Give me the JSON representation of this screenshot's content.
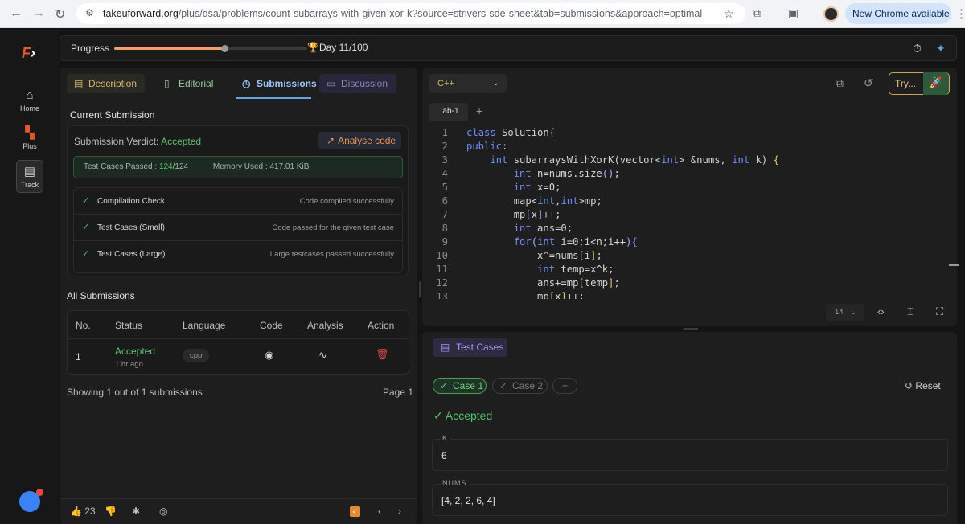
{
  "browser": {
    "url_host": "takeuforward.org",
    "url_path": "/plus/dsa/problems/count-subarrays-with-given-xor-k?source=strivers-sde-sheet&tab=submissions&approach=optimal",
    "new_chrome": "New Chrome available"
  },
  "rail": {
    "logo_letter": "F",
    "items": [
      {
        "label": "Home",
        "icon": "home-icon"
      },
      {
        "label": "Plus",
        "icon": "grid-icon"
      },
      {
        "label": "Track",
        "icon": "document-icon"
      }
    ]
  },
  "progress": {
    "label": "Progress",
    "fraction": 0.11,
    "trophy": "🏆",
    "day_text": "Day 11/100"
  },
  "tabs": {
    "description": "Description",
    "editorial": "Editorial",
    "submissions": "Submissions",
    "discussion": "Discussion",
    "active": "submissions"
  },
  "current": {
    "heading": "Current Submission",
    "verdict_label": "Submission Verdict:",
    "verdict": "Accepted",
    "analyse_button": "Analyse code",
    "tests_passed_label": "Test Cases Passed :",
    "tests_passed": "124",
    "tests_total": "/124",
    "memory_used": "Memory Used : 417.01 KiB",
    "checks": [
      {
        "name": "Compilation Check",
        "detail": "Code compiled successfully"
      },
      {
        "name": "Test Cases (Small)",
        "detail": "Code passed for the given test case"
      },
      {
        "name": "Test Cases (Large)",
        "detail": "Large testcases passed successfully"
      }
    ]
  },
  "all": {
    "heading": "All Submissions",
    "columns": [
      "No.",
      "Status",
      "Language",
      "Code",
      "Analysis",
      "Action"
    ],
    "rows": [
      {
        "no": "1",
        "status": "Accepted",
        "time": "1 hr ago",
        "language": "cpp"
      }
    ],
    "showing": "Showing 1 out of 1 submissions",
    "page": "Page 1"
  },
  "footer": {
    "likes": "23"
  },
  "editor": {
    "language": "C++",
    "try_label": "Try...",
    "tab": "Tab-1",
    "font_size": "14",
    "lines": [
      "1",
      "2",
      "3",
      "4",
      "5",
      "6",
      "7",
      "8",
      "9",
      "10",
      "11",
      "12",
      "13"
    ]
  },
  "tests": {
    "title": "Test Cases",
    "case1": "Case 1",
    "case2": "Case 2",
    "reset": "Reset",
    "result": "Accepted",
    "k_label": "K",
    "k_value": "6",
    "nums_label": "NUMS",
    "nums_value": "[4, 2, 2, 6, 4]"
  },
  "colors": {
    "accepted": "#55c46a",
    "accent_blue": "#6aa2e6",
    "progress_fill": "#f59e6b"
  }
}
